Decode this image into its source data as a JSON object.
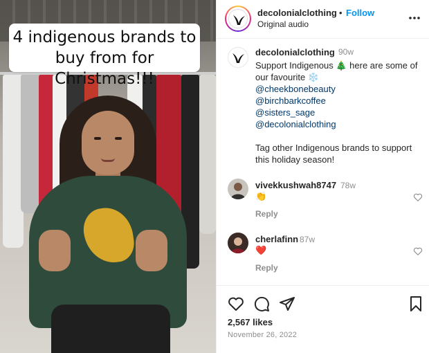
{
  "video": {
    "caption_line1": "4 indigenous brands to",
    "caption_line2": "buy from for Christmas!!!"
  },
  "header": {
    "username": "decolonialclothing",
    "separator": "•",
    "follow_label": "Follow",
    "audio": "Original audio"
  },
  "post": {
    "username": "decolonialclothing",
    "time": "90w",
    "text_line1": "Support Indigenous 🎄 here are some of",
    "text_line2": "our favourite ❄️",
    "mentions": [
      "@cheekbonebeauty",
      "@birchbarkcoffee",
      "@sisters_sage",
      "@decolonialclothing"
    ],
    "outro_line1": "Tag other Indigenous brands to support",
    "outro_line2": "this holiday season!"
  },
  "comments": [
    {
      "username": "vivekkushwah8747",
      "time": "78w",
      "text": "👏",
      "reply_label": "Reply"
    },
    {
      "username": "cherlafinn",
      "time": "87w",
      "text": "❤️",
      "reply_label": "Reply"
    }
  ],
  "footer": {
    "likes": "2,567 likes",
    "date": "November 26, 2022"
  },
  "colors": {
    "link_blue": "#0095f6",
    "mention_blue": "#00376b",
    "muted": "#8e8e8e"
  }
}
